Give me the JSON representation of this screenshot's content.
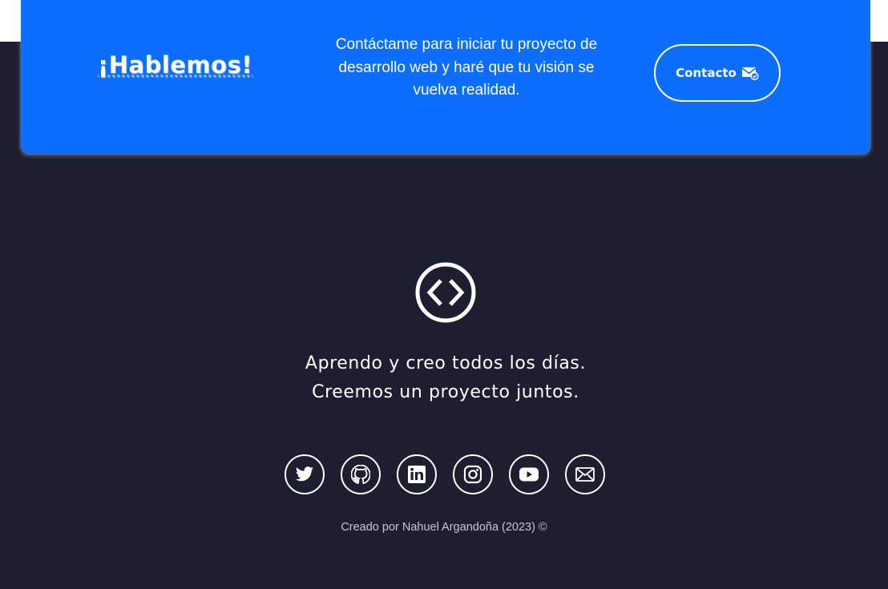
{
  "colors": {
    "page_background": "#1d1e30",
    "card_accent": "#0d6efd",
    "text": "#ffffff",
    "muted_text": "#c4c6d3"
  },
  "cta": {
    "title": "¡Hablemos!",
    "text": "Contáctame para iniciar tu proyecto de desarrollo web y haré que tu visión se vuelva realidad.",
    "button_label": "Contacto",
    "button_icon": "mail-check-icon"
  },
  "footer": {
    "logo_icon": "code-brackets-icon",
    "tagline_line1": "Aprendo y creo todos los días.",
    "tagline_line2": "Creemos un proyecto juntos.",
    "social_icons": [
      "twitter-icon",
      "github-icon",
      "linkedin-icon",
      "instagram-icon",
      "youtube-icon",
      "mail-icon"
    ],
    "credit": "Creado por Nahuel Argandoña (2023) ©"
  }
}
